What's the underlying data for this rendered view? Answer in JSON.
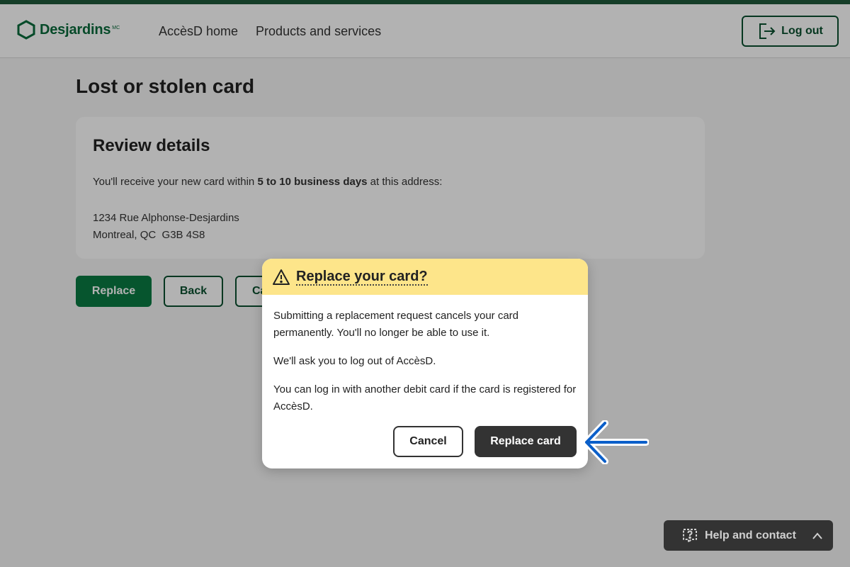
{
  "brand": {
    "name": "Desjardins",
    "tm": "MC",
    "color": "#0a6b3b"
  },
  "nav": {
    "items": [
      {
        "label": "AccèsD home"
      },
      {
        "label": "Products and services"
      }
    ]
  },
  "header": {
    "logout_label": "Log out",
    "logout_icon": "logout-icon"
  },
  "page": {
    "title": "Lost or stolen card",
    "review": {
      "heading": "Review details",
      "info_pre": "You'll receive your new card within ",
      "info_bold": "5 to 10 business days",
      "info_post": " at this address:",
      "address_line1": "1234 Rue Alphonse-Desjardins",
      "address_line2": "Montreal, QC  G3B 4S8"
    },
    "actions": {
      "replace_label": "Replace",
      "back_label": "Back",
      "cancel_label": "Ca"
    }
  },
  "modal": {
    "title": "Replace your card?",
    "icon": "warning-icon",
    "paragraphs": [
      "Submitting a replacement request cancels your card permanently. You'll no longer be able to use it.",
      "We'll ask you to log out of AccèsD.",
      "You can log in with another debit card if the card is registered for AccèsD."
    ],
    "cancel_label": "Cancel",
    "confirm_label": "Replace card"
  },
  "annotation": {
    "icon": "arrow-left-icon",
    "color": "#0b5fc9"
  },
  "help": {
    "label": "Help and contact",
    "icon": "help-chat-icon",
    "chevron": "chevron-up-icon"
  }
}
